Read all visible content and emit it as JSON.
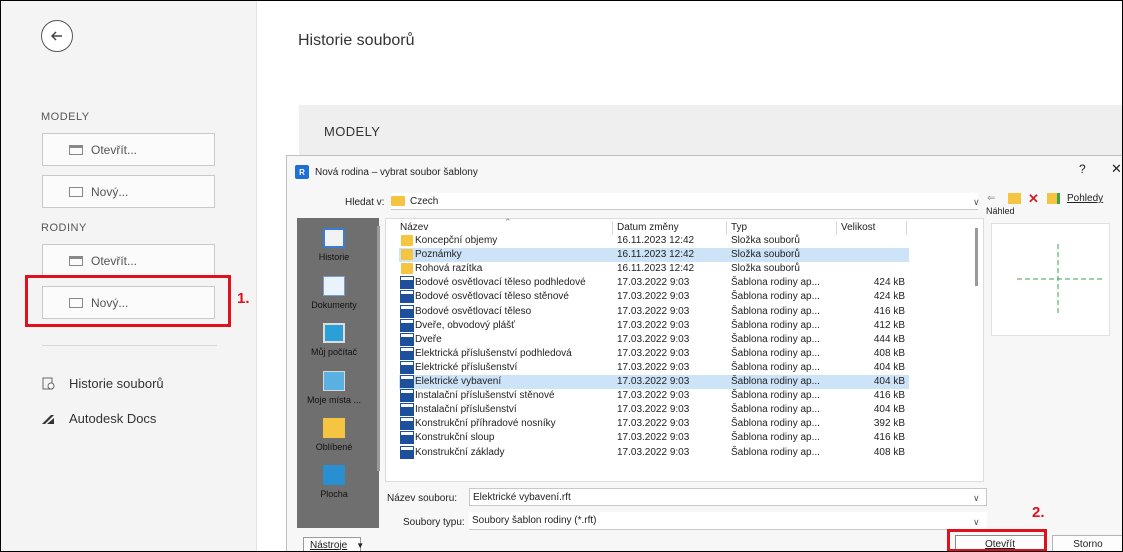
{
  "left_panel": {
    "models_label": "MODELY",
    "models_open": "Otevřít...",
    "models_new": "Nový...",
    "families_label": "RODINY",
    "families_open": "Otevřít...",
    "families_new": "Nový...",
    "nav": [
      {
        "label": "Historie souborů",
        "icon": "history-icon"
      },
      {
        "label": "Autodesk Docs",
        "icon": "autodesk-docs-icon"
      }
    ]
  },
  "annotations": {
    "step1": "1.",
    "step2": "2.",
    "color": "#e0101c"
  },
  "main": {
    "title": "Historie souborů",
    "models_header": "MODELY"
  },
  "dialog": {
    "title": "Nová rodina – vybrat soubor šablony",
    "help": "?",
    "close": "✕",
    "look_in_label": "Hledat v:",
    "look_in_value": "Czech",
    "views_label": "Pohledy",
    "preview_label": "Náhled",
    "places": [
      "Historie",
      "Dokumenty",
      "Můj počítač",
      "Moje místa ...",
      "Oblíbené",
      "Plocha"
    ],
    "columns": {
      "name": "Název",
      "date": "Datum změny",
      "type": "Typ",
      "size": "Velikost"
    },
    "files": [
      {
        "name": "Koncepční objemy",
        "date": "16.11.2023 12:42",
        "type": "Složka souborů",
        "size": "",
        "kind": "folder",
        "selected": false
      },
      {
        "name": "Poznámky",
        "date": "16.11.2023 12:42",
        "type": "Složka souborů",
        "size": "",
        "kind": "folder",
        "selected": true
      },
      {
        "name": "Rohová razítka",
        "date": "16.11.2023 12:42",
        "type": "Složka souborů",
        "size": "",
        "kind": "folder",
        "selected": false
      },
      {
        "name": "Bodové osvětlovací těleso podhledové",
        "date": "17.03.2022 9:03",
        "type": "Šablona rodiny ap...",
        "size": "424 kB",
        "kind": "rft",
        "selected": false
      },
      {
        "name": "Bodové osvětlovací těleso stěnové",
        "date": "17.03.2022 9:03",
        "type": "Šablona rodiny ap...",
        "size": "424 kB",
        "kind": "rft",
        "selected": false
      },
      {
        "name": "Bodové osvětlovací těleso",
        "date": "17.03.2022 9:03",
        "type": "Šablona rodiny ap...",
        "size": "416 kB",
        "kind": "rft",
        "selected": false
      },
      {
        "name": "Dveře, obvodový plášť",
        "date": "17.03.2022 9:03",
        "type": "Šablona rodiny ap...",
        "size": "412 kB",
        "kind": "rft",
        "selected": false
      },
      {
        "name": "Dveře",
        "date": "17.03.2022 9:03",
        "type": "Šablona rodiny ap...",
        "size": "444 kB",
        "kind": "rft",
        "selected": false
      },
      {
        "name": "Elektrická příslušenství podhledová",
        "date": "17.03.2022 9:03",
        "type": "Šablona rodiny ap...",
        "size": "408 kB",
        "kind": "rft",
        "selected": false
      },
      {
        "name": "Elektrické příslušenství",
        "date": "17.03.2022 9:03",
        "type": "Šablona rodiny ap...",
        "size": "404 kB",
        "kind": "rft",
        "selected": false
      },
      {
        "name": "Elektrické vybavení",
        "date": "17.03.2022 9:03",
        "type": "Šablona rodiny ap...",
        "size": "404 kB",
        "kind": "rft",
        "selected": true
      },
      {
        "name": "Instalační příslušenství stěnové",
        "date": "17.03.2022 9:03",
        "type": "Šablona rodiny ap...",
        "size": "416 kB",
        "kind": "rft",
        "selected": false
      },
      {
        "name": "Instalační příslušenství",
        "date": "17.03.2022 9:03",
        "type": "Šablona rodiny ap...",
        "size": "404 kB",
        "kind": "rft",
        "selected": false
      },
      {
        "name": "Konstrukční příhradové nosníky",
        "date": "17.03.2022 9:03",
        "type": "Šablona rodiny ap...",
        "size": "392 kB",
        "kind": "rft",
        "selected": false
      },
      {
        "name": "Konstrukční sloup",
        "date": "17.03.2022 9:03",
        "type": "Šablona rodiny ap...",
        "size": "416 kB",
        "kind": "rft",
        "selected": false
      },
      {
        "name": "Konstrukční základy",
        "date": "17.03.2022 9:03",
        "type": "Šablona rodiny ap...",
        "size": "408 kB",
        "kind": "rft",
        "selected": false
      }
    ],
    "filename_label": "Název souboru:",
    "filename_value": "Elektrické vybavení.rft",
    "filetype_label": "Soubory typu:",
    "filetype_value": "Soubory šablon rodiny  (*.rft)",
    "tools_label": "Nástroje",
    "open_label": "Otevřít",
    "cancel_label": "Storno"
  }
}
